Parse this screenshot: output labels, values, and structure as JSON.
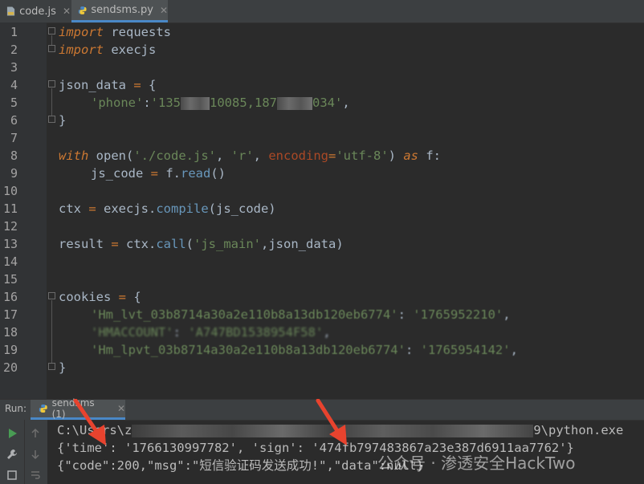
{
  "tabs": [
    {
      "label": "code.js",
      "icon": "js-file-icon",
      "active": false
    },
    {
      "label": "sendsms.py",
      "icon": "python-file-icon",
      "active": true
    }
  ],
  "line_numbers": [
    "1",
    "2",
    "3",
    "4",
    "5",
    "6",
    "7",
    "8",
    "9",
    "10",
    "11",
    "12",
    "13",
    "14",
    "15",
    "16",
    "17",
    "18",
    "19",
    "20"
  ],
  "code": {
    "l1_kw": "import",
    "l1_rest": " requests",
    "l2_kw": "import",
    "l2_rest": " execjs",
    "l4_a": "json_data ",
    "l4_eq": "=",
    "l4_b": " {",
    "l5_a": "'phone'",
    "l5_b": ":",
    "l5_c": "'135",
    "l5_d": "10085,187",
    "l5_e": "034'",
    "l5_f": ",",
    "l6": "}",
    "l8_with": "with",
    "l8_open": " open(",
    "l8_s1": "'./code.js'",
    "l8_c1": ", ",
    "l8_s2": "'r'",
    "l8_c2": ", ",
    "l8_enc": "encoding",
    "l8_eq": "=",
    "l8_s3": "'utf-8'",
    "l8_cl": ") ",
    "l8_as": "as",
    "l8_f": " f:",
    "l9_a": "js_code ",
    "l9_eq": "=",
    "l9_b": " f.",
    "l9_m": "read",
    "l9_c": "()",
    "l11_a": "ctx ",
    "l11_eq": "=",
    "l11_b": " execjs.",
    "l11_m": "compile",
    "l11_c": "(js_code)",
    "l13_a": "result ",
    "l13_eq": "=",
    "l13_b": " ctx.",
    "l13_m": "call",
    "l13_c": "(",
    "l13_s": "'js_main'",
    "l13_d": ",json_data)",
    "l16_a": "cookies ",
    "l16_eq": "=",
    "l16_b": " {",
    "l17_k": "'Hm_lvt_03b8714a30a2e110b8a13db120eb6774'",
    "l17_c": ": ",
    "l17_v": "'1765952210'",
    "l17_e": ",",
    "l18_k": "'HMACCOUNT'",
    "l18_c": ": ",
    "l18_v": "'A747BD1538954F58'",
    "l18_e": ",",
    "l19_k": "'Hm_lpvt_03b8714a30a2e110b8a13db120eb6774'",
    "l19_c": ": ",
    "l19_v": "'1765954142'",
    "l19_e": ",",
    "l20": "}"
  },
  "run_panel": {
    "label": "Run:",
    "tab_label": "sendsms (1)",
    "cmd_start": "C:\\Users\\z",
    "cmd_end": "9\\python.exe",
    "output_line1": "{'time': '1766130997782', 'sign': '474fb797483867a23e387d6911aa7762'}",
    "output_line2": "{\"code\":200,\"msg\":\"短信验证码发送成功!\",\"data\":null}"
  },
  "watermark": "公众号 · 渗透安全HackTwo",
  "colors": {
    "background": "#2b2b2b",
    "keyword": "#cc7832",
    "string": "#6a8759",
    "arrow": "#e8432e"
  }
}
